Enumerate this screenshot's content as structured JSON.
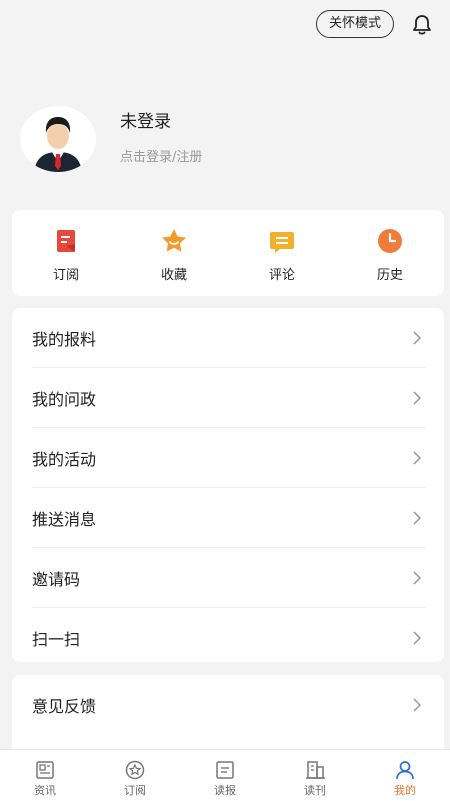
{
  "header": {
    "care_mode_label": "关怀模式"
  },
  "profile": {
    "name": "未登录",
    "subtitle": "点击登录/注册"
  },
  "quick_actions": [
    {
      "label": "订阅",
      "icon": "subscribe-icon",
      "color": "#e8483b"
    },
    {
      "label": "收藏",
      "icon": "star-icon",
      "color": "#f39a2b"
    },
    {
      "label": "评论",
      "icon": "comment-icon",
      "color": "#f2b12c"
    },
    {
      "label": "历史",
      "icon": "clock-icon",
      "color": "#f07c3b"
    }
  ],
  "menu_group1": [
    {
      "label": "我的报料"
    },
    {
      "label": "我的问政"
    },
    {
      "label": "我的活动"
    },
    {
      "label": "推送消息"
    },
    {
      "label": "邀请码"
    },
    {
      "label": "扫一扫"
    }
  ],
  "menu_group2": [
    {
      "label": "意见反馈"
    }
  ],
  "tabs": [
    {
      "label": "资讯",
      "icon": "news-icon",
      "active": false
    },
    {
      "label": "订阅",
      "icon": "subscribe-tab-icon",
      "active": false
    },
    {
      "label": "读报",
      "icon": "newspaper-icon",
      "active": false
    },
    {
      "label": "读刊",
      "icon": "magazine-icon",
      "active": false
    },
    {
      "label": "我的",
      "icon": "user-icon",
      "active": true
    }
  ],
  "colors": {
    "accent": "#e07a2e",
    "background": "#f3f3f3"
  }
}
